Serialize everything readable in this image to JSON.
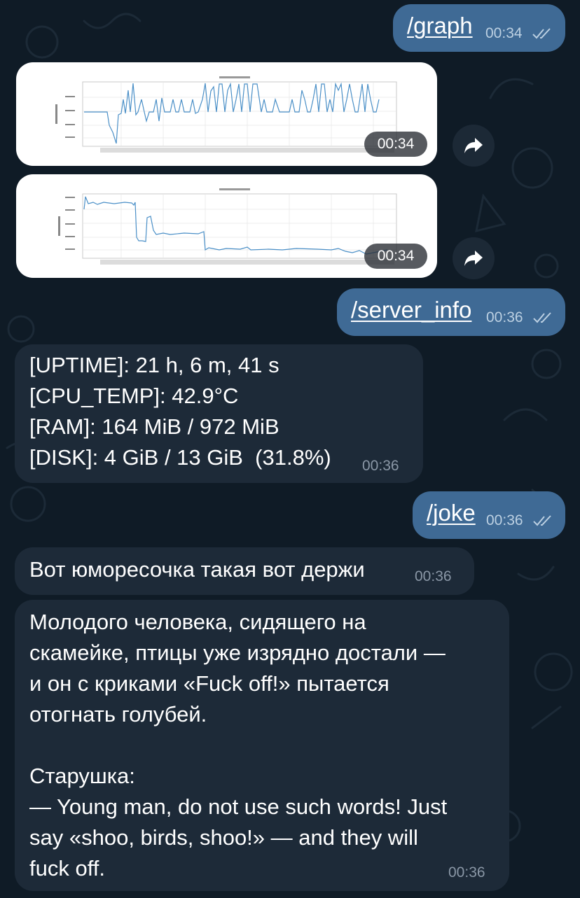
{
  "messages": {
    "graph_cmd": {
      "text": "/graph",
      "time": "00:34"
    },
    "photo1": {
      "time": "00:34"
    },
    "photo2": {
      "time": "00:34"
    },
    "server_cmd": {
      "text": "/server_info",
      "time": "00:36"
    },
    "server_info": {
      "lines": [
        "[UPTIME]: 21 h, 6 m, 41 s",
        "[CPU_TEMP]: 42.9°C",
        "[RAM]: 164 MiB / 972 MiB",
        "[DISK]: 4 GiB / 13 GiB  (31.8%)"
      ],
      "time": "00:36"
    },
    "joke_cmd": {
      "text": "/joke",
      "time": "00:36"
    },
    "joke_intro": {
      "text": "Вот юморесочка такая вот держи",
      "time": "00:36"
    },
    "joke": {
      "lines": [
        "Молодого человека, сидящего на",
        "скамейке, птицы уже изрядно достали —",
        "и он с криками «Fuck off!» пытается",
        "отогнать голубей.",
        "",
        "Старушка:",
        "— Young man, do not use such words! Just",
        "say «shoo, birds, shoo!» — and they will",
        "fuck off."
      ],
      "time": "00:36"
    }
  },
  "colors": {
    "background": "#0f1b26",
    "outgoing_bubble": "#3f6a95",
    "incoming_bubble": "#1d2a38"
  },
  "icons": [
    "double-check-icon",
    "forward-icon"
  ]
}
